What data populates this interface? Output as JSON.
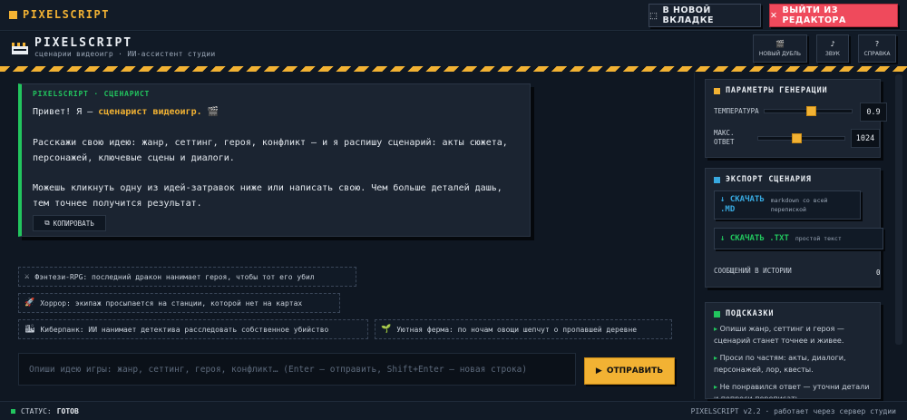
{
  "topbar": {
    "logo": "PIXELSCRIPT",
    "new_tab": "В НОВОЙ ВКЛАДКЕ",
    "exit": "ВЫЙТИ ИЗ РЕДАКТОРА"
  },
  "header": {
    "title": "PIXELSCRIPT",
    "subtitle": "сценарии видеоигр · ИИ-ассистент студии",
    "buttons": [
      {
        "label": "НОВЫЙ ДУБЛЬ",
        "icon": "clapper-icon"
      },
      {
        "label": "ЗВУК",
        "icon": "music-note-icon"
      },
      {
        "label": "СПРАВКА",
        "icon": "question-icon"
      }
    ]
  },
  "message": {
    "author": "PIXELSCRIPT · СЦЕНАРИСТ",
    "greeting_prefix": "Привет! Я — ",
    "greeting_highlight": "сценарист видеоигр.",
    "para2_line1": "Расскажи свою идею: жанр, сеттинг, героя, конфликт — и я распишу сценарий: акты сюжета,",
    "para2_line2": "персонажей, ключевые сцены и диалоги.",
    "para3_line1": "Можешь кликнуть одну из идей-затравок ниже или написать свою. Чем больше деталей дашь,",
    "para3_line2": "тем точнее получится результат.",
    "copy_label": "КОПИРОВАТЬ"
  },
  "chips": [
    {
      "icon": "sword-icon",
      "glyph": "⚔",
      "text": "Фэнтези-RPG: последний дракон нанимает героя, чтобы тот его убил"
    },
    {
      "icon": "rocket-icon",
      "glyph": "🚀",
      "text": "Хоррор: экипаж просыпается на станции, которой нет на картах"
    },
    {
      "icon": "cyberpunk-icon",
      "glyph": "🏙",
      "text": "Киберпанк: ИИ нанимает детектива расследовать собственное убийство"
    },
    {
      "icon": "sprout-icon",
      "glyph": "🌱",
      "text": "Уютная ферма: по ночам овощи шепчут о пропавшей деревне"
    }
  ],
  "composer": {
    "placeholder": "Опиши идею игры: жанр, сеттинг, героя, конфликт… (Enter — отправить, Shift+Enter — новая строка)",
    "send_label": "ОТПРАВИТЬ"
  },
  "params": {
    "title": "ПАРАМЕТРЫ ГЕНЕРАЦИИ",
    "temperature_label": "ТЕМПЕРАТУРА",
    "temperature_value": "0.9",
    "temperature_fraction": 0.9,
    "max_label_1": "МАКС.",
    "max_label_2": "ОТВЕТ",
    "max_value": "1024",
    "max_fraction": 0.45
  },
  "export": {
    "title": "ЭКСПОРТ СЦЕНАРИЯ",
    "md_label_1": "СКАЧАТЬ",
    "md_label_2": ".MD",
    "md_desc_1": "markdown со всей",
    "md_desc_2": "перепиской",
    "txt_label": "СКАЧАТЬ .TXT",
    "txt_desc": "простой текст",
    "history_label": "СООБЩЕНИЙ В ИСТОРИИ",
    "history_count": "0"
  },
  "tips": {
    "title": "ПОДСКАЗКИ",
    "items": [
      "Опиши жанр, сеттинг и героя — сценарий станет точнее и живее.",
      "Проси по частям: акты, диалоги, персонажей, лор, квесты.",
      "Не понравился ответ — уточни детали и попроси переписать."
    ]
  },
  "status": {
    "label": "СТАТУС:",
    "value": "ГОТОВ",
    "right": "PIXELSCRIPT v2.2 · работает через сервер студии"
  },
  "colors": {
    "accent": "#f2b233",
    "success": "#22c55e",
    "danger": "#ef4a5c",
    "info": "#38a9e0",
    "bg": "#0f1722"
  }
}
